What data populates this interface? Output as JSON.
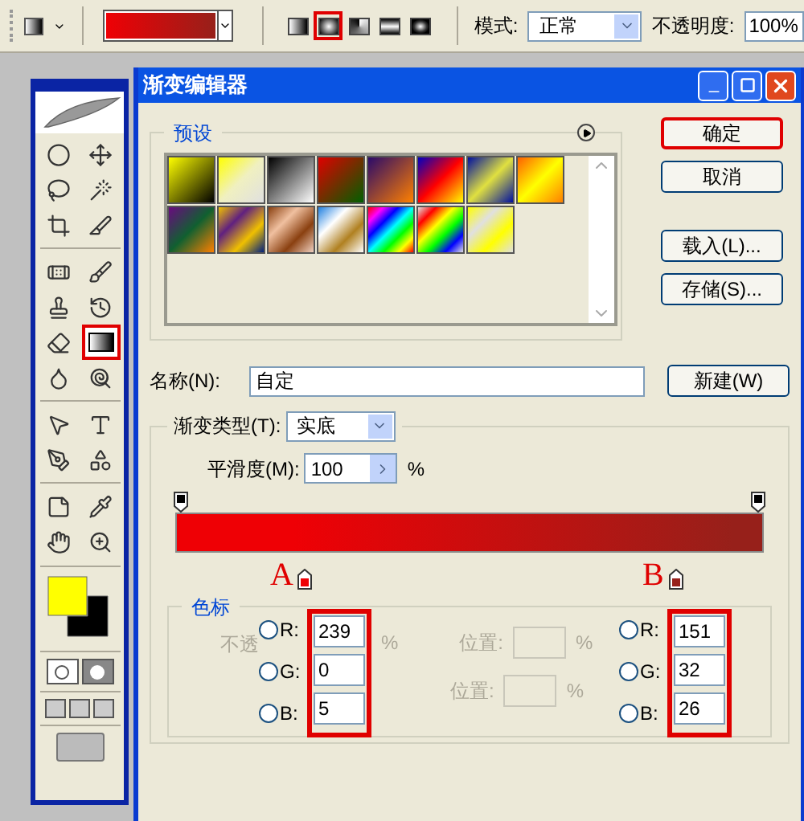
{
  "options_bar": {
    "gradient_styles": [
      {
        "kind": "linear",
        "selected": false
      },
      {
        "kind": "radial",
        "selected": true
      },
      {
        "kind": "angle",
        "selected": false
      },
      {
        "kind": "reflected",
        "selected": false
      },
      {
        "kind": "diamond",
        "selected": false
      }
    ],
    "mode_label": "模式:",
    "mode_value": "正常",
    "opacity_label": "不透明度:",
    "opacity_value": "100%"
  },
  "toolbox": {
    "tools": [
      {
        "kind": "marquee",
        "selected": false
      },
      {
        "kind": "move",
        "selected": false
      },
      {
        "kind": "lasso",
        "selected": false
      },
      {
        "kind": "wand",
        "selected": false
      },
      {
        "kind": "crop",
        "selected": false
      },
      {
        "kind": "slice",
        "selected": false
      },
      {
        "kind": "heal",
        "selected": false
      },
      {
        "kind": "brush",
        "selected": false
      },
      {
        "kind": "stamp",
        "selected": false
      },
      {
        "kind": "history",
        "selected": false
      },
      {
        "kind": "eraser",
        "selected": false
      },
      {
        "kind": "gradient",
        "selected": true
      },
      {
        "kind": "blur",
        "selected": false
      },
      {
        "kind": "dodge",
        "selected": false
      },
      {
        "kind": "path",
        "selected": false
      },
      {
        "kind": "type",
        "selected": false
      },
      {
        "kind": "pen",
        "selected": false
      },
      {
        "kind": "shape",
        "selected": false
      },
      {
        "kind": "notes",
        "selected": false
      },
      {
        "kind": "eyedropper",
        "selected": false
      },
      {
        "kind": "hand",
        "selected": false
      },
      {
        "kind": "zoom",
        "selected": false
      }
    ],
    "color_swatches": [
      {
        "kind": "foreground",
        "color": "#ffff00"
      },
      {
        "kind": "background",
        "color": "#000000"
      }
    ]
  },
  "dialog": {
    "title": "渐变编辑器",
    "presets_label": "预设",
    "buttons": [
      {
        "label": "确定",
        "highlighted": true
      },
      {
        "label": "取消",
        "highlighted": false
      },
      {
        "label": "载入(L)...",
        "highlighted": false
      },
      {
        "label": "存储(S)...",
        "highlighted": false
      }
    ],
    "name_label": "名称(N):",
    "name_value": "自定",
    "new_button": "新建(W)",
    "type_label": "渐变类型(T):",
    "type_value": "实底",
    "smoothness_label": "平滑度(M):",
    "smoothness_value": "100",
    "smoothness_unit": "%",
    "color_stops": [
      {
        "label": "A",
        "color": "#ef0005"
      },
      {
        "label": "B",
        "color": "#97201a"
      }
    ],
    "stops_section": {
      "title": "色标",
      "opacity_label": "不透",
      "opacity_unit": "%",
      "location_rows": [
        {
          "label": "位置:",
          "unit": "%",
          "disabled": true
        },
        {
          "label": "位置:",
          "unit": "%",
          "disabled": true
        }
      ],
      "stop_fields": [
        {
          "highlighted": true,
          "channels": [
            {
              "label": "R:",
              "value": "239",
              "selected": false
            },
            {
              "label": "G:",
              "value": "0",
              "selected": false
            },
            {
              "label": "B:",
              "value": "5",
              "selected": false
            }
          ]
        },
        {
          "highlighted": true,
          "channels": [
            {
              "label": "R:",
              "value": "151",
              "selected": false
            },
            {
              "label": "G:",
              "value": "32",
              "selected": false
            },
            {
              "label": "B:",
              "value": "26",
              "selected": false
            }
          ]
        }
      ]
    }
  }
}
